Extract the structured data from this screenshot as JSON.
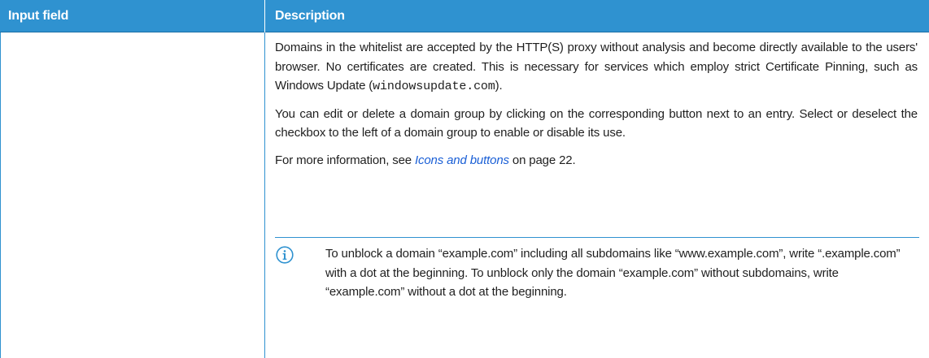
{
  "table": {
    "columns": [
      "Input field",
      "Description"
    ]
  },
  "description": {
    "p1_text": "Domains in the whitelist are accepted by the HTTP(S) proxy without analysis and become directly available to the users' browser. No certificates are created. This is necessary for services which employ strict Certificate Pinning, such as Windows Update (",
    "p1_code": "windowsupdate.com",
    "p1_end": ").",
    "p2": "You can edit or delete a domain group by clicking on the corresponding button next to an entry. Select or deselect the checkbox to the left of a domain group to enable or disable its use.",
    "p3_before": "For more information, see ",
    "p3_link": "Icons and buttons",
    "p3_after": " on page 22."
  },
  "note": {
    "icon": "info-icon",
    "text": "To unblock a domain “example.com” including all subdomains like “www.example.com”, write “.example.com” with a dot at the beginning. To unblock only the domain “example.com” without subdomains, write “example.com” without a dot at the beginning."
  },
  "colors": {
    "header_bg": "#2f92d0",
    "header_text": "#ffffff",
    "link": "#1a5fd6"
  }
}
